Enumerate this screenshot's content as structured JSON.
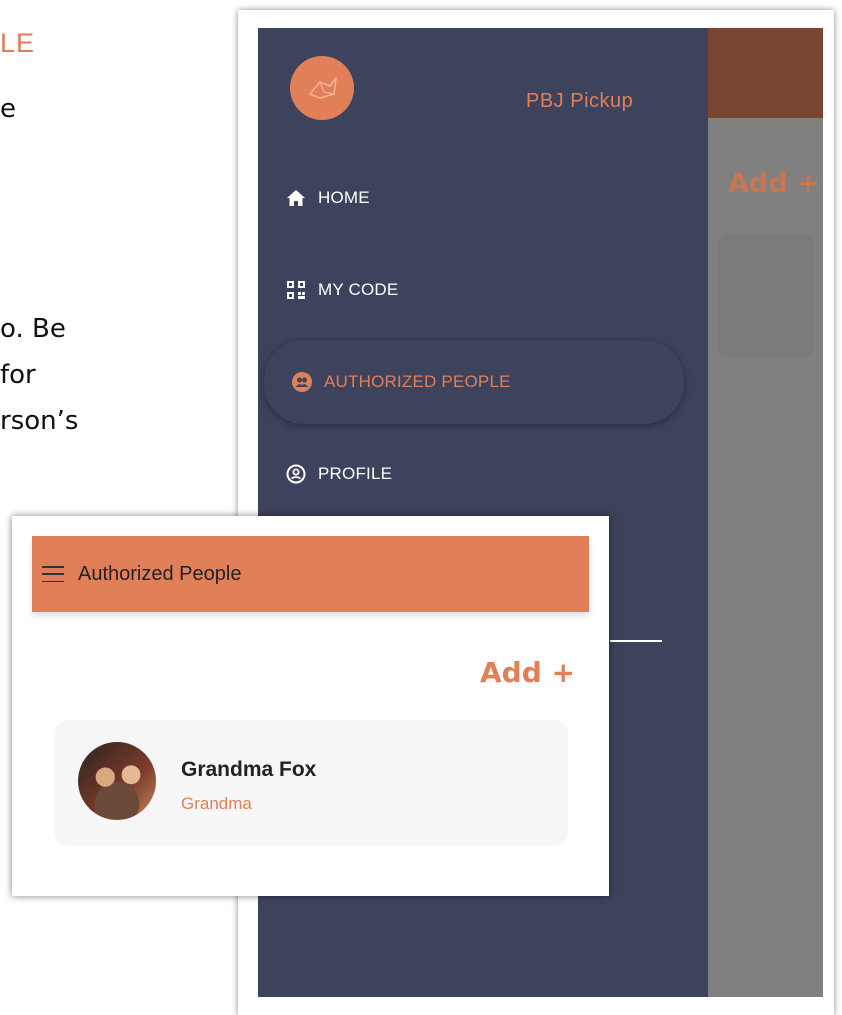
{
  "background_doc": {
    "heading_fragment": "LE",
    "lines": [
      "e",
      "o. Be",
      "for",
      "rson’s"
    ]
  },
  "drawer": {
    "app_name": "PBJ Pickup",
    "items": [
      {
        "label": "HOME",
        "icon": "home-icon"
      },
      {
        "label": "MY CODE",
        "icon": "qr-code-icon"
      },
      {
        "label": "AUTHORIZED PEOPLE",
        "icon": "people-icon"
      },
      {
        "label": "PROFILE",
        "icon": "profile-icon"
      }
    ]
  },
  "behind_screen": {
    "add_label": "Add +"
  },
  "authorized_screen": {
    "title": "Authorized People",
    "add_label": "Add +",
    "people": [
      {
        "name": "Grandma Fox",
        "relation": "Grandma"
      }
    ]
  },
  "colors": {
    "accent": "#e07f58",
    "drawer_bg": "#3d435c",
    "header_dark": "#7a4531"
  }
}
